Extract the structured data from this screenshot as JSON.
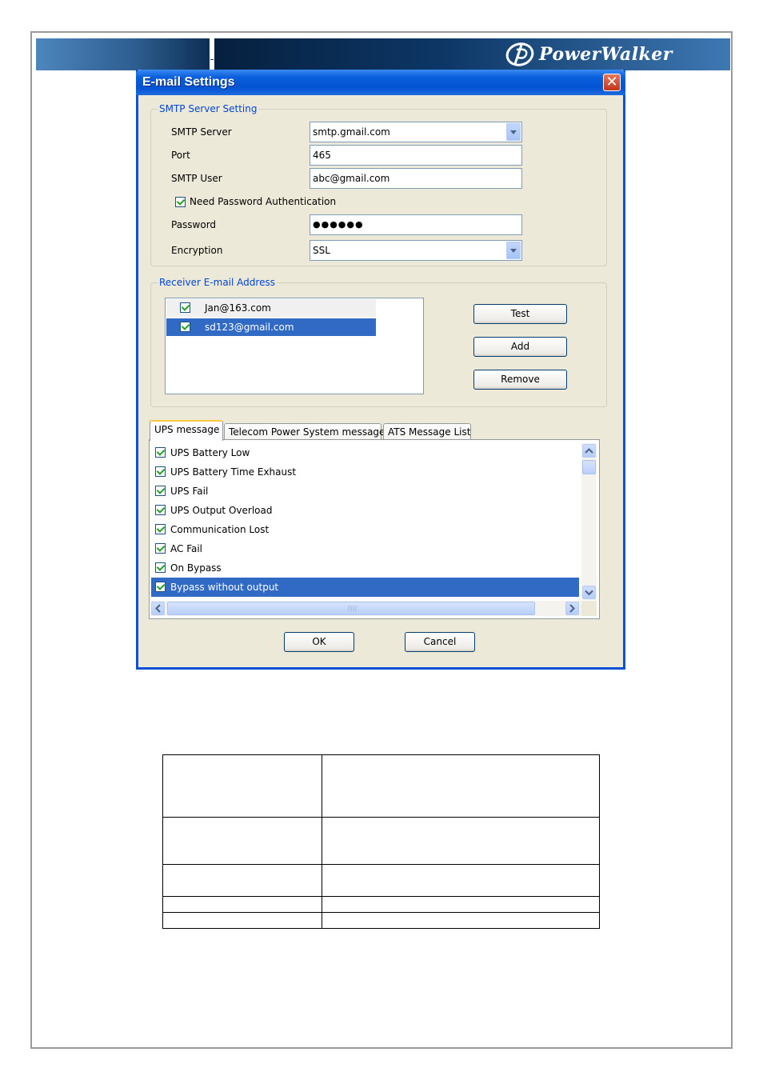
{
  "header": {
    "logo_text": "PowerWalker"
  },
  "dialog": {
    "title": "E-mail Settings",
    "smtp_group": {
      "legend": "SMTP Server Setting",
      "smtp_server_label": "SMTP Server",
      "smtp_server_value": "smtp.gmail.com",
      "port_label": "Port",
      "port_value": "465",
      "smtp_user_label": "SMTP User",
      "smtp_user_value": "abc@gmail.com",
      "need_auth_label": "Need Password Authentication",
      "need_auth_checked": true,
      "password_label": "Password",
      "password_value": "●●●●●●",
      "encryption_label": "Encryption",
      "encryption_value": "SSL"
    },
    "receiver_group": {
      "legend": "Receiver E-mail Address",
      "addresses": [
        {
          "email": "Jan@163.com",
          "checked": true,
          "selected": false
        },
        {
          "email": "sd123@gmail.com",
          "checked": true,
          "selected": true
        }
      ],
      "test_button": "Test",
      "add_button": "Add",
      "remove_button": "Remove"
    },
    "tabs": [
      "UPS message",
      "Telecom Power System message",
      "ATS Message List"
    ],
    "active_tab": "UPS message",
    "messages": [
      {
        "label": "UPS Battery Low",
        "checked": true
      },
      {
        "label": "UPS Battery Time Exhaust",
        "checked": true
      },
      {
        "label": "UPS Fail",
        "checked": true
      },
      {
        "label": "UPS Output Overload",
        "checked": true
      },
      {
        "label": "Communication Lost",
        "checked": true
      },
      {
        "label": "AC Fail",
        "checked": true
      },
      {
        "label": "On Bypass",
        "checked": true
      },
      {
        "label": "Bypass without output",
        "checked": true
      }
    ],
    "ok_button": "OK",
    "cancel_button": "Cancel"
  },
  "colors": {
    "dialog_bg": "#ece9d8",
    "titlebar": "#0a5fdc",
    "selection": "#316ac5",
    "group_legend": "#0046d5"
  }
}
